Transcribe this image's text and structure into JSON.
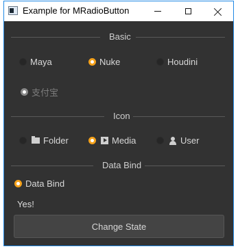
{
  "window": {
    "title": "Example for MRadioButton"
  },
  "sections": {
    "basic": "Basic",
    "icon": "Icon",
    "data_bind": "Data Bind"
  },
  "basic_options": [
    {
      "label": "Maya",
      "checked": false,
      "enabled": true
    },
    {
      "label": "Nuke",
      "checked": true,
      "enabled": true
    },
    {
      "label": "Houdini",
      "checked": false,
      "enabled": true
    },
    {
      "label": "支付宝",
      "checked": true,
      "enabled": false
    }
  ],
  "icon_options": [
    {
      "label": "Folder",
      "icon": "folder-icon",
      "checked": false
    },
    {
      "label": "Media",
      "icon": "media-icon",
      "checked": true
    },
    {
      "label": "User",
      "icon": "user-icon",
      "checked": false
    }
  ],
  "data_bind": {
    "radio_label": "Data Bind",
    "checked": true,
    "status_text": "Yes!",
    "button_label": "Change State"
  },
  "colors": {
    "accent": "#f5a21b",
    "background": "#323232",
    "text": "#dcdcdc"
  }
}
